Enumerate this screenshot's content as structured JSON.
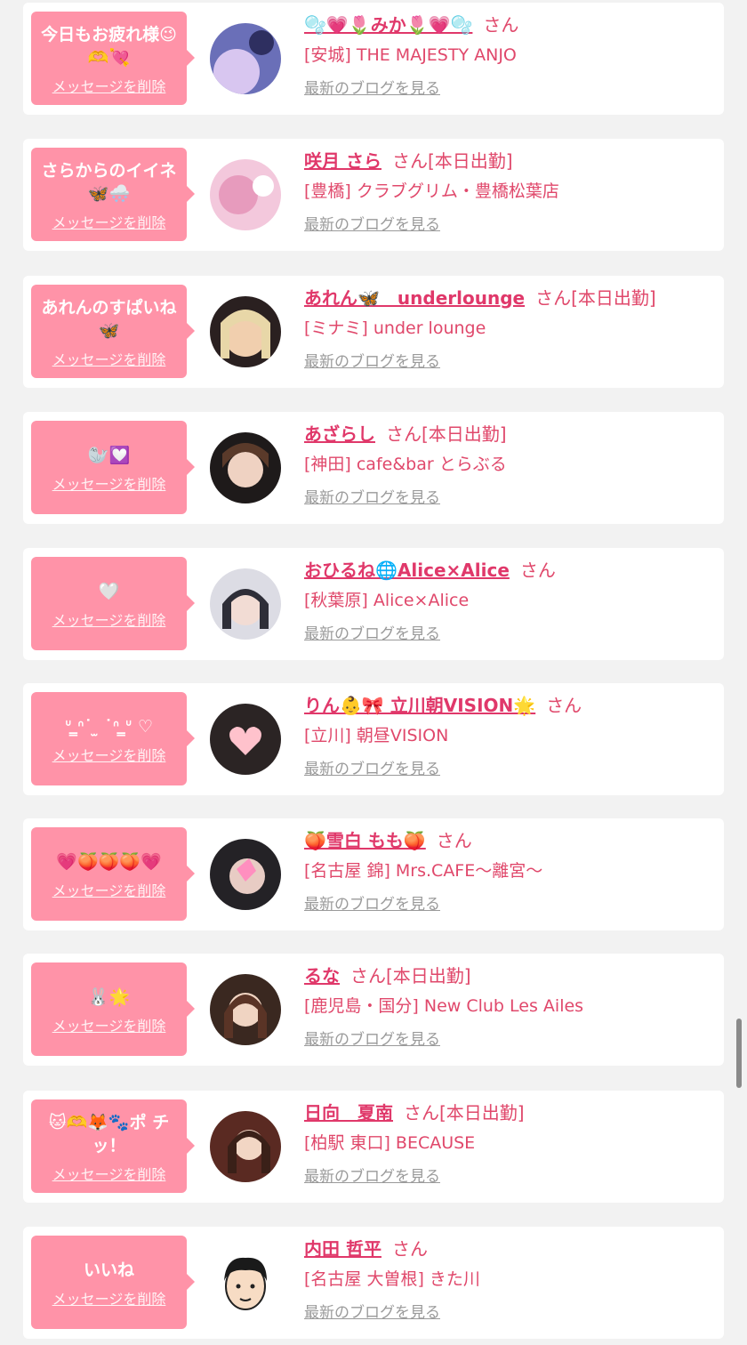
{
  "colors": {
    "accent": "#e0386a",
    "bubble": "#ff93a8",
    "background": "#f2f2f2",
    "link_gray": "#9a9a9a"
  },
  "items": [
    {
      "message": "今日もお疲れ様😉 🫶💘",
      "delete_label": "メッセージを削除",
      "name": "🫧💗🌷みか🌷💗🫧",
      "honorific": "さん",
      "status": "",
      "shop": "[安城] THE MAJESTY ANJO",
      "blog_label": "最新のブログを見る",
      "avatar_color": "#6a6fb8"
    },
    {
      "message": "さらからのイイネ 🦋🌨️",
      "delete_label": "メッセージを削除",
      "name": "咲月 さら",
      "honorific": "さん",
      "status": "[本日出勤]",
      "shop": "[豊橋] クラブグリム・豊橋松葉店",
      "blog_label": "最新のブログを見る",
      "avatar_color": "#e7a7c4"
    },
    {
      "message": "あれんのすぱいね 🦋",
      "delete_label": "メッセージを削除",
      "name": "あれん🦋　underlounge",
      "honorific": "さん",
      "status": "[本日出勤]",
      "shop": "[ミナミ] under lounge",
      "blog_label": "最新のブログを見る",
      "avatar_color": "#caa37e"
    },
    {
      "message": "🦭💟",
      "delete_label": "メッセージを削除",
      "name": "あざらし",
      "honorific": "さん",
      "status": "[本日出勤]",
      "shop": "[神田] cafe&bar とらぶる",
      "blog_label": "最新のブログを見る",
      "avatar_color": "#3a2a26"
    },
    {
      "message": "🤍",
      "delete_label": "メッセージを削除",
      "name": "おひるね🌐Alice×Alice",
      "honorific": "さん",
      "status": "",
      "shop": "[秋葉原] Alice×Alice",
      "blog_label": "最新のブログを見る",
      "avatar_color": "#4a4a55"
    },
    {
      "message": "ᐡ ̳ᐢ˙ ̫ ˙ᐢ ̳ᐡ ♡",
      "delete_label": "メッセージを削除",
      "name": "りん👶🎀 立川朝VISION🌟",
      "honorific": "さん",
      "status": "",
      "shop": "[立川] 朝昼VISION",
      "blog_label": "最新のブログを見る",
      "avatar_color": "#3b3030"
    },
    {
      "message": "💗🍑🍑🍑💗",
      "delete_label": "メッセージを削除",
      "name": "🍑雪白 もも🍑",
      "honorific": "さん",
      "status": "",
      "shop": "[名古屋 錦] Mrs.CAFE～離宮～",
      "blog_label": "最新のブログを見る",
      "avatar_color": "#2c2b30"
    },
    {
      "message": "🐰🌟",
      "delete_label": "メッセージを削除",
      "name": "るな",
      "honorific": "さん",
      "status": "[本日出勤]",
      "shop": "[鹿児島・国分] New Club Les Ailes",
      "blog_label": "最新のブログを見る",
      "avatar_color": "#4a3328"
    },
    {
      "message": "🐱🫶🦊🐾ポ チッ！",
      "delete_label": "メッセージを削除",
      "name": "日向　夏南",
      "honorific": "さん",
      "status": "[本日出勤]",
      "shop": "[柏駅 東口] BECAUSE",
      "blog_label": "最新のブログを見る",
      "avatar_color": "#5a2a22"
    },
    {
      "message": "いいね",
      "delete_label": "メッセージを削除",
      "name": "内田 哲平",
      "honorific": "さん",
      "status": "",
      "shop": "[名古屋 大曽根] きた川",
      "blog_label": "最新のブログを見る",
      "avatar_color": "#ffffff"
    }
  ]
}
